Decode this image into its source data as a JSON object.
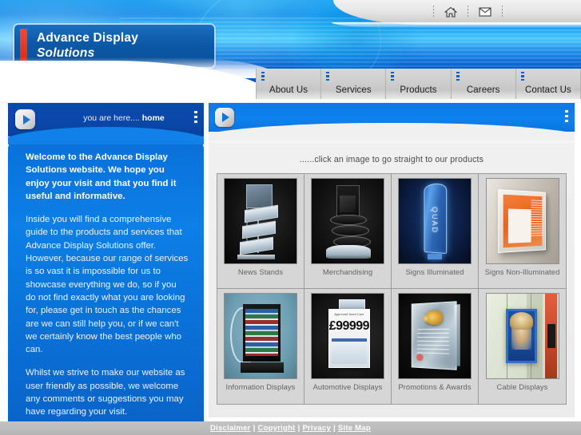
{
  "site": {
    "logo_line1": "Advance Display",
    "logo_line2": "Solutions"
  },
  "header": {
    "utility_icons": [
      {
        "name": "home-icon",
        "glyph": "home"
      },
      {
        "name": "email-icon",
        "glyph": "envelope"
      }
    ],
    "nav": [
      {
        "label": "About Us"
      },
      {
        "label": "Services"
      },
      {
        "label": "Products"
      },
      {
        "label": "Careers"
      },
      {
        "label": "Contact Us"
      }
    ]
  },
  "left_panel": {
    "breadcrumb_prefix": "you are here.... ",
    "breadcrumb_current": "home",
    "play_icon": "play-icon",
    "menu_icon": "vertical-dots-icon",
    "paragraphs": [
      "Welcome to the Advance Display Solutions website. We hope you enjoy your visit and that you find it useful and informative.",
      "Inside you will find a comprehensive guide to the products and services that Advance Display Solutions offer. However, because our range of services is so vast it is impossible for us to showcase everything we do, so if you do not find exactly what you are looking for, please get in touch as the chances are we can still help you, or if we can't we certainly know the best people who can.",
      "Whilst we strive to make our website as user friendly as possible, we welcome any comments or suggestions you may have regarding your visit."
    ]
  },
  "right_panel": {
    "play_icon": "play-icon",
    "menu_icon": "vertical-dots-icon",
    "tagline": "......click an image to go straight to our products",
    "products": [
      {
        "label": "News Stands"
      },
      {
        "label": "Merchandising"
      },
      {
        "label": "Signs Illuminated",
        "sign_text": "QUAD"
      },
      {
        "label": "Signs Non-Illuminated"
      },
      {
        "label": "Information Displays"
      },
      {
        "label": "Automotive Displays",
        "card_heading": "Approved Used Cars",
        "card_price": "£99999"
      },
      {
        "label": "Promotions & Awards"
      },
      {
        "label": "Cable Displays"
      }
    ]
  },
  "footer": {
    "links": [
      {
        "label": "Disclaimer"
      },
      {
        "label": "Copyright"
      },
      {
        "label": "Privacy"
      },
      {
        "label": "Site Map"
      }
    ],
    "separator": "|"
  },
  "colors": {
    "banner_blue": "#0d82ef",
    "logo_navy": "#0a4f99",
    "logo_accent_red": "#e8301c",
    "panel_blue": "#0d7fe6",
    "panel_navy": "#0a47a8",
    "nav_grey": "#cfcfcf",
    "footer_grey": "#bdbdbd"
  }
}
